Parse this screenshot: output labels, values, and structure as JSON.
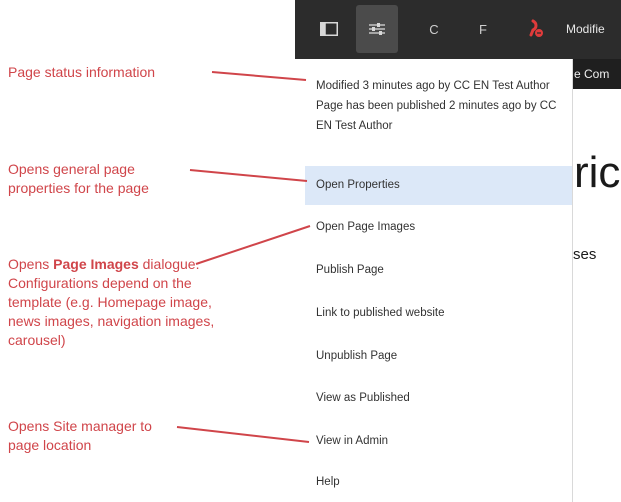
{
  "toolbar": {
    "btn_c": "C",
    "btn_f": "F",
    "status_text": "Modifie",
    "strip_text": "e Com"
  },
  "page": {
    "heading_fragment": "ric",
    "body_fragment": "ses"
  },
  "menu": {
    "status_line1": "Modified 3 minutes ago by CC EN Test Author",
    "status_line2": "Page has been published 2 minutes ago by CC EN Test Author",
    "items": [
      {
        "label": "Open Properties"
      },
      {
        "label": "Open Page Images"
      },
      {
        "label": "Publish Page"
      },
      {
        "label": "Link to published website"
      },
      {
        "label": "Unpublish Page"
      },
      {
        "label": "View as Published"
      },
      {
        "label": "View in Admin"
      },
      {
        "label": "Help"
      }
    ]
  },
  "annotations": {
    "status": "Page status information",
    "properties": "Opens general page properties for the page",
    "images_prefix": "Opens ",
    "images_bold": "Page Images",
    "images_rest": " dialogue. Configurations depend on the template (e.g. Homepage image, news images, navigation images, carousel)",
    "site_manager": "Opens Site manager to page location"
  },
  "colors": {
    "annotation": "#d0454a",
    "highlight": "#dce8f8",
    "toolbar": "#2c2c2c"
  },
  "icons": [
    "sidebar-panel-icon",
    "properties-sliders-icon",
    "publish-status-icon"
  ]
}
